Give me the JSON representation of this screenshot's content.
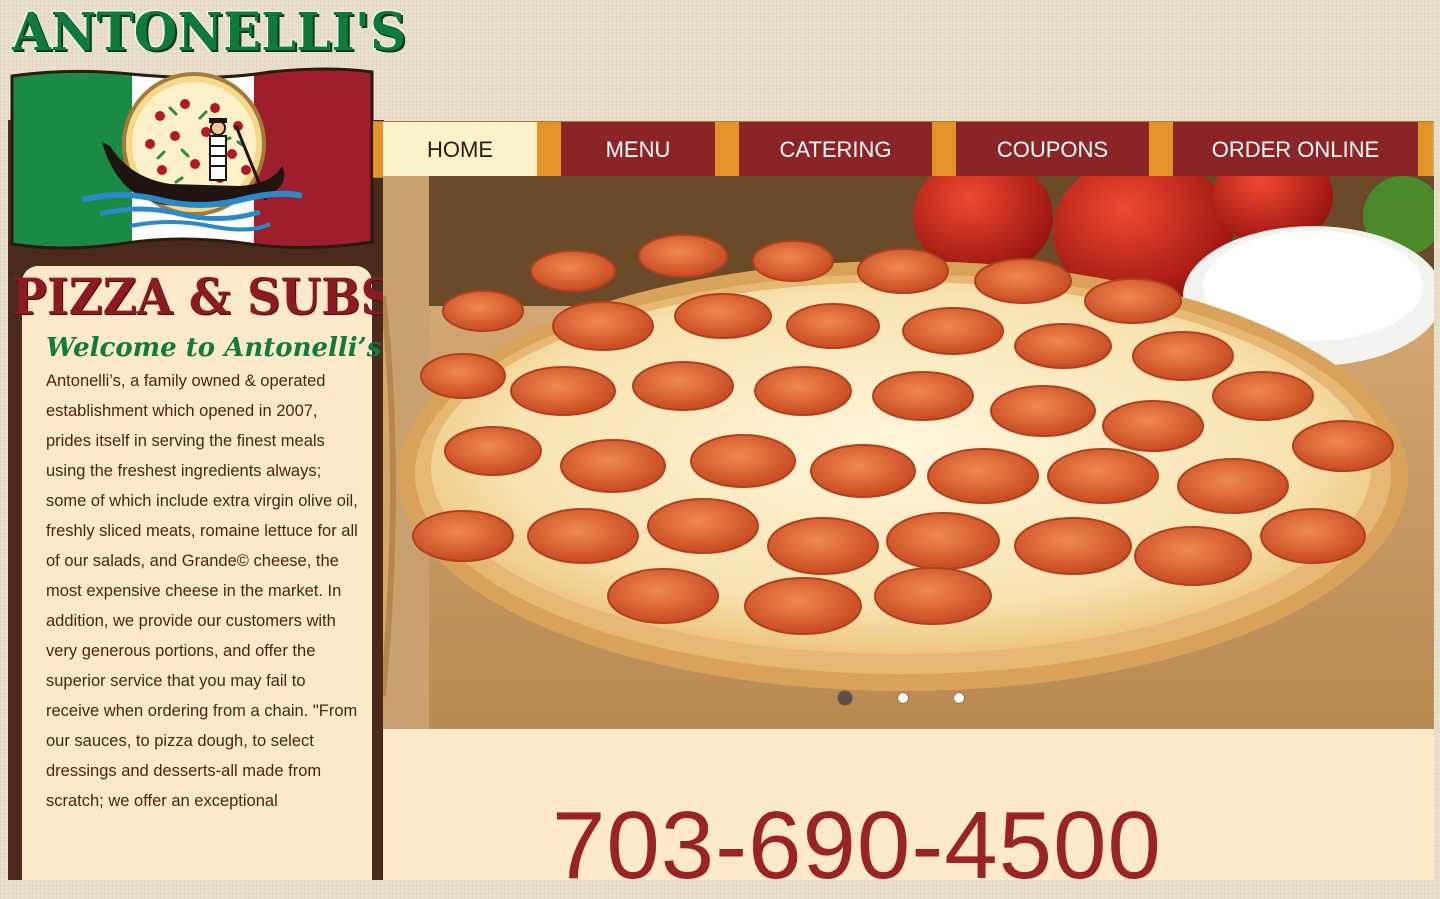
{
  "brand": {
    "logo_word": "ANTONELLI'S",
    "tagline": "PIZZA & SUBS",
    "logo_icon": "gondola-pizza-icon"
  },
  "nav": {
    "items": [
      {
        "label": "HOME",
        "active": true
      },
      {
        "label": "MENU",
        "active": false
      },
      {
        "label": "CATERING",
        "active": false
      },
      {
        "label": "COUPONS",
        "active": false
      },
      {
        "label": "ORDER ONLINE",
        "active": false
      }
    ]
  },
  "sidebar": {
    "welcome_title": "Welcome to Antonelli’s",
    "about_text": "Antonelli’s, a family owned & operated establishment which opened in 2007, prides itself in serving the finest meals using the freshest ingredients always; some of which include extra virgin olive oil, freshly sliced meats, romaine lettuce for all of our salads, and Grande© cheese, the most expensive cheese in the market. In addition, we provide our customers with very generous portions, and offer the superior service that you may fail to receive when ordering from a chain. \"From our sauces, to pizza dough, to select dressings and desserts-all made from scratch; we offer an exceptional"
  },
  "hero": {
    "image": "pepperoni-pizza-photo",
    "slides": 3,
    "active_slide": 1
  },
  "contact": {
    "phone": "703-690-4500"
  },
  "colors": {
    "nav_red": "#8b2426",
    "nav_orange": "#e39429",
    "nav_active": "#faf2c9",
    "brand_green": "#0f7a3a",
    "brand_red": "#8b1a23",
    "panel_cream": "#fbe9c9",
    "phone_red": "#9a2328"
  }
}
